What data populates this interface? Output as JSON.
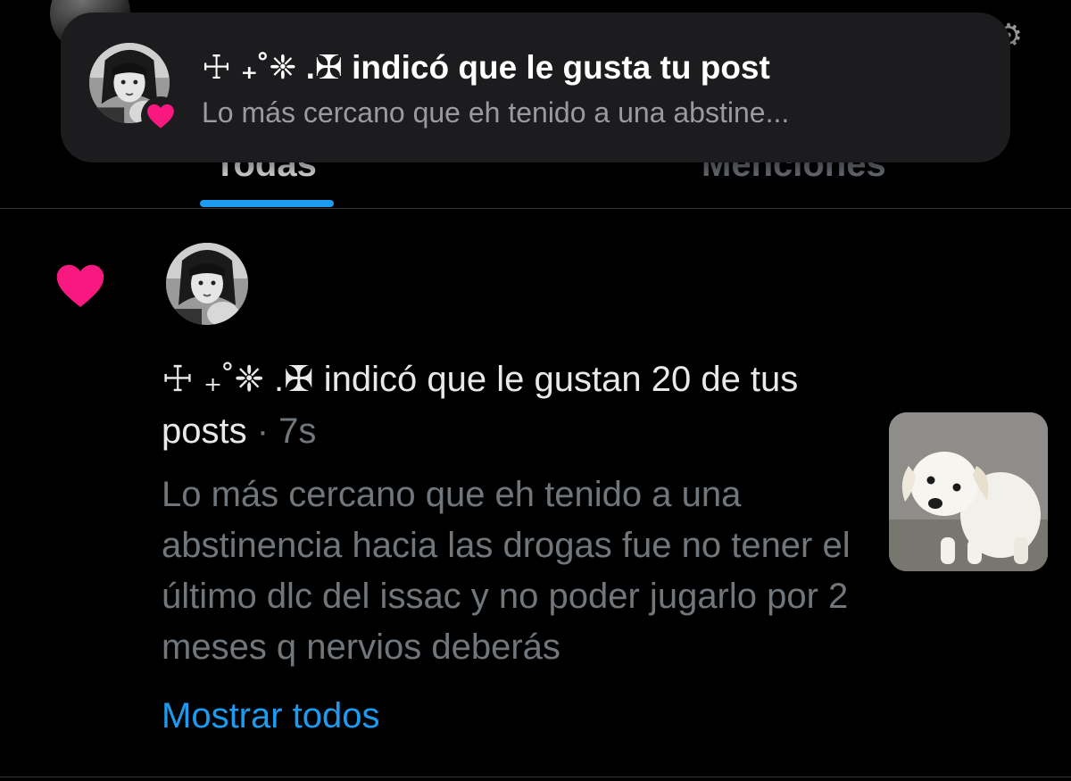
{
  "banner": {
    "title": "☩ ₊˚❈ .✠ indicó que le gusta tu post",
    "subtitle": "Lo más cercano que eh tenido a una abstine..."
  },
  "tabs": [
    {
      "label": "Todas"
    },
    {
      "label": "Menciones"
    }
  ],
  "notification": {
    "text": "☩ ₊˚❈ .✠ indicó que le gustan 20 de tus posts",
    "separator": " · ",
    "time": "7s",
    "preview": "Lo más cercano que eh tenido a una abstinencia hacia las drogas fue no tener el último dlc del issac y no poder jugarlo por 2 meses q nervios deberás",
    "show_all": "Mostrar todos"
  },
  "colors": {
    "accent": "#1d9bf0",
    "like": "#f91880",
    "background": "#000000",
    "banner_bg": "#1c1c1e"
  },
  "icons": {
    "like": "heart-icon",
    "settings": "gear-icon"
  }
}
